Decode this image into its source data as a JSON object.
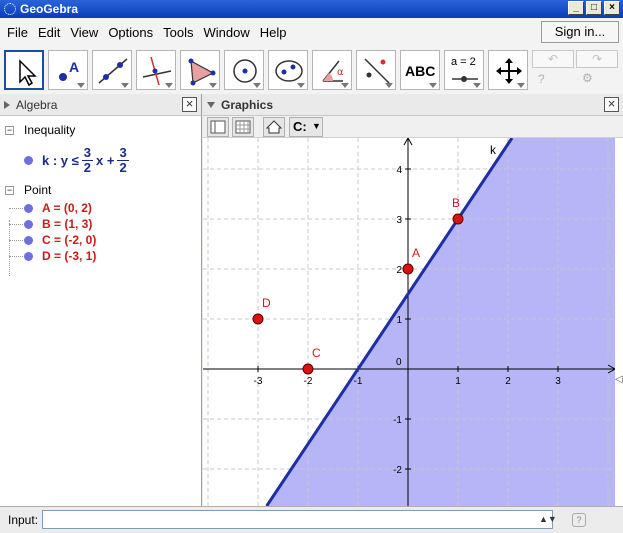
{
  "app": {
    "title": "GeoGebra"
  },
  "menu": {
    "items": [
      "File",
      "Edit",
      "View",
      "Options",
      "Tools",
      "Window",
      "Help"
    ],
    "signin": "Sign in..."
  },
  "toolbar": {
    "tools": [
      "move-tool",
      "point-tool",
      "line-tool",
      "perpendicular-tool",
      "polygon-tool",
      "circle-tool",
      "conic-tool",
      "angle-tool",
      "reflect-tool",
      "text-tool",
      "slider-tool",
      "move-view-tool"
    ],
    "text_tool_label": "ABC",
    "slider_tool_label": "a = 2",
    "undo_glyph": "↶",
    "redo_glyph": "↷",
    "help_glyph": "?",
    "settings_glyph": "⚙"
  },
  "algebra": {
    "title": "Algebra",
    "close": "×",
    "inequality_category": "Inequality",
    "inequality": {
      "lhs": "k : y ≤",
      "frac1_num": "3",
      "frac1_den": "2",
      "middle": "x +",
      "frac2_num": "3",
      "frac2_den": "2"
    },
    "point_category": "Point",
    "points": [
      "A = (0, 2)",
      "B = (1, 3)",
      "C = (-2, 0)",
      "D = (-3, 1)"
    ]
  },
  "graphics": {
    "title": "Graphics",
    "close": "×",
    "line_label": "k",
    "x_ticks": [
      "-3",
      "-2",
      "-1",
      "0",
      "1",
      "2",
      "3"
    ],
    "y_ticks": [
      "4",
      "3",
      "2",
      "1",
      "-1",
      "-2"
    ],
    "points": [
      {
        "label": "A",
        "x": 0,
        "y": 2
      },
      {
        "label": "B",
        "x": 1,
        "y": 3
      },
      {
        "label": "C",
        "x": -2,
        "y": 0
      },
      {
        "label": "D",
        "x": -3,
        "y": 1
      }
    ],
    "line": {
      "slope": 1.5,
      "intercept": 1.5
    },
    "colors": {
      "region": "#a8a8f6",
      "line": "#1d2ea6",
      "point": "#dd1111",
      "label": "#cc1a1a",
      "grid": "#c8c8c8"
    }
  },
  "input": {
    "label": "Input:",
    "value": ""
  }
}
